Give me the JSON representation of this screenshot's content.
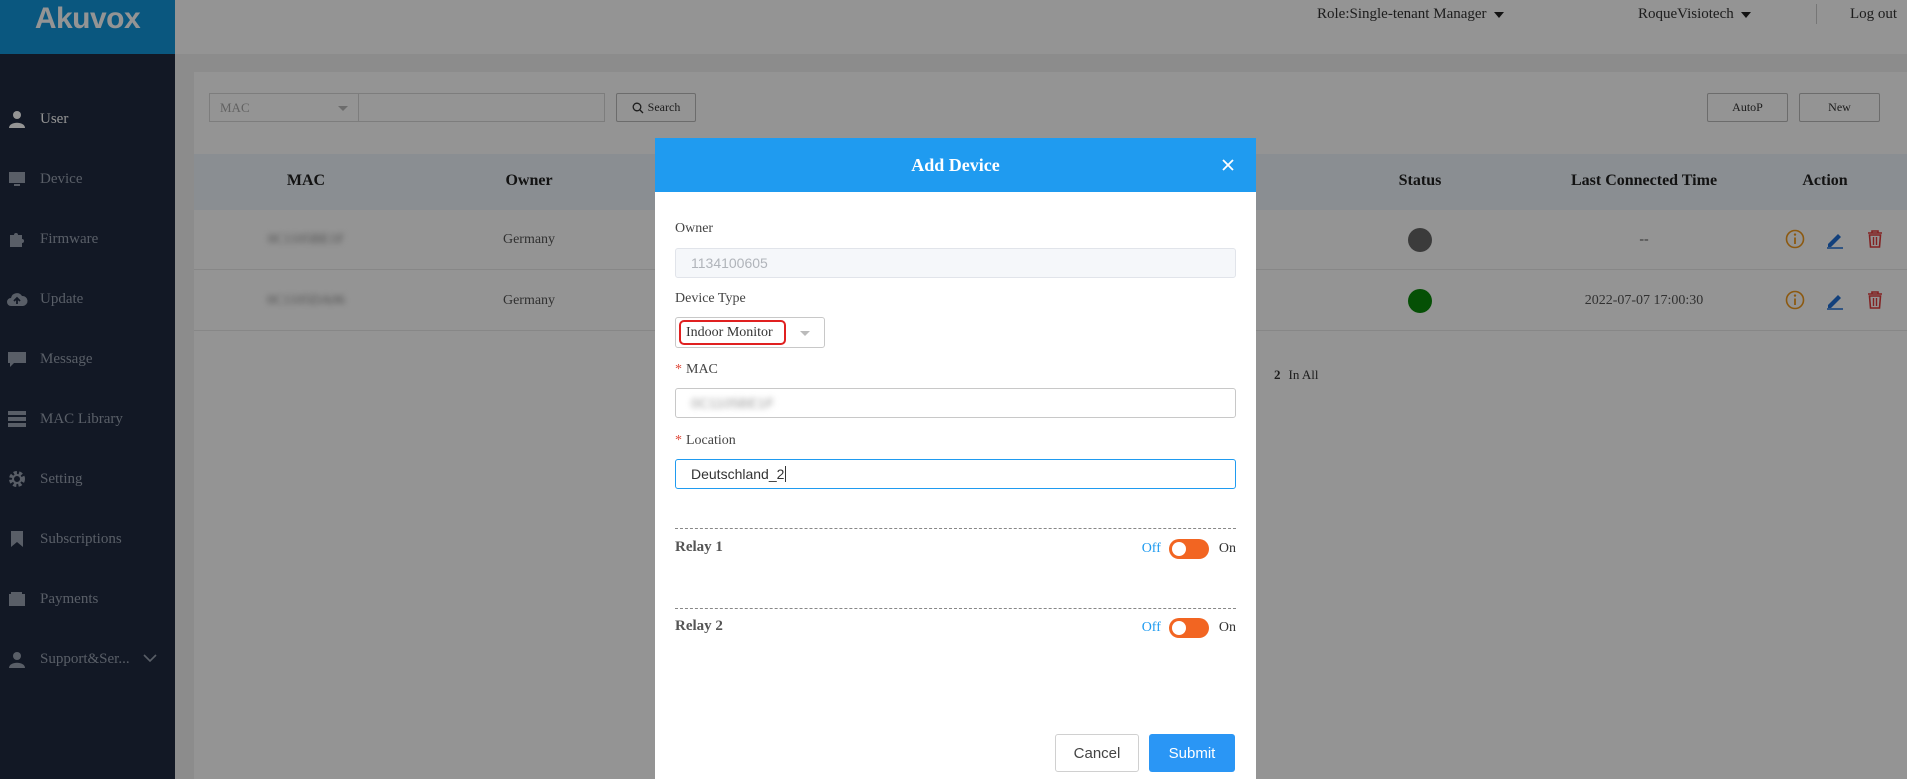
{
  "app": {
    "logo": "Akuvox",
    "accent": "#1296db"
  },
  "header": {
    "role": "Role:Single-tenant Manager",
    "account": "RoqueVisiotech",
    "logout": "Log out"
  },
  "sidebar": {
    "items": [
      {
        "label": "User",
        "icon": "user-icon",
        "active": true
      },
      {
        "label": "Device",
        "icon": "device-icon"
      },
      {
        "label": "Firmware",
        "icon": "puzzle-icon"
      },
      {
        "label": "Update",
        "icon": "cloud-upload-icon"
      },
      {
        "label": "Message",
        "icon": "message-icon"
      },
      {
        "label": "MAC Library",
        "icon": "server-icon"
      },
      {
        "label": "Setting",
        "icon": "gear-icon"
      },
      {
        "label": "Subscriptions",
        "icon": "bookmark-icon"
      },
      {
        "label": "Payments",
        "icon": "wallet-icon"
      },
      {
        "label": "Support&Ser...",
        "icon": "support-icon"
      }
    ]
  },
  "search": {
    "field": "MAC",
    "button": "Search"
  },
  "toolbar": {
    "autop": "AutoP",
    "new": "New"
  },
  "table": {
    "columns": [
      "MAC",
      "Owner",
      "Status",
      "Last Connected Time",
      "Action"
    ],
    "rows": [
      {
        "mac": "0C1105BE1F",
        "owner": "Germany",
        "status": "offline",
        "status_color": "#666666",
        "last_connected": "--"
      },
      {
        "mac": "0C1105DA06",
        "owner": "Germany",
        "status": "online",
        "status_color": "#0a8a0a",
        "last_connected": "2022-07-07 17:00:30"
      }
    ]
  },
  "pager": {
    "count": "2",
    "label": "In All"
  },
  "modal": {
    "title": "Add Device",
    "owner_label": "Owner",
    "owner_value": "1134100605",
    "device_type_label": "Device Type",
    "device_type_value": "Indoor Monitor",
    "mac_label": "MAC",
    "mac_value": "0C1105BE1F",
    "location_label": "Location",
    "location_value": "Deutschland_2",
    "relay1": {
      "label": "Relay 1",
      "off": "Off",
      "on": "On"
    },
    "relay2": {
      "label": "Relay 2",
      "off": "Off",
      "on": "On"
    },
    "cancel": "Cancel",
    "submit": "Submit",
    "switch_color": "#f26522",
    "header_color": "#1f9bf0"
  }
}
